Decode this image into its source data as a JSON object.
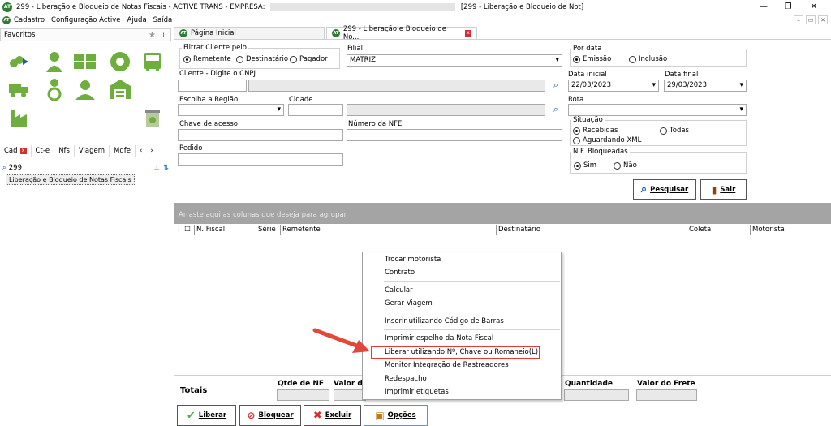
{
  "window": {
    "title_left": "299 - Liberação e Bloqueio de Notas Fiscais - ACTIVE TRANS - EMPRESA:",
    "title_right": "[299 - Liberação e Bloqueio de Not]"
  },
  "menu": [
    "Cadastro",
    "Configuração Active",
    "Ajuda",
    "Saída"
  ],
  "left": {
    "favorites_label": "Favoritos",
    "tabs": [
      "Cad",
      "Ct-e",
      "Nfs",
      "Viagem",
      "Mdfe"
    ],
    "search_value": "299",
    "tree_item": "Liberação e Bloqueio de Notas Fiscais"
  },
  "main_tabs": [
    {
      "label": "Página Inicial"
    },
    {
      "label": "299 - Liberação e Bloqueio de No..."
    }
  ],
  "form": {
    "filtrar_cliente": {
      "title": "Filtrar Cliente pelo",
      "options": [
        "Remetente",
        "Destinatário",
        "Pagador"
      ]
    },
    "filial": {
      "label": "Filial",
      "value": "MATRIZ"
    },
    "por_data": {
      "title": "Por data",
      "options": [
        "Emissão",
        "Inclusão"
      ]
    },
    "cliente_label": "Cliente - Digite o CNPJ",
    "data_inicial": {
      "label": "Data inicial",
      "value": "22/03/2023"
    },
    "data_final": {
      "label": "Data final",
      "value": "29/03/2023"
    },
    "escolha_regiao_label": "Escolha a Região",
    "cidade_label": "Cidade",
    "rota_label": "Rota",
    "situacao": {
      "title": "Situação",
      "options": [
        "Recebidas",
        "Todas",
        "Aguardando XML"
      ]
    },
    "chave_label": "Chave de acesso",
    "numero_nfe_label": "Número da NFE",
    "nf_bloqueadas": {
      "title": "N.F. Bloqueadas",
      "options": [
        "Sim",
        "Não"
      ]
    },
    "pedido_label": "Pedido",
    "pesquisar": "Pesquisar",
    "sair": "Sair"
  },
  "grid": {
    "group_hint": "Arraste aqui as colunas que deseja para agrupar",
    "columns": [
      "N. Fiscal",
      "Série",
      "Remetente",
      "Destinatário",
      "Coleta",
      "Motorista"
    ]
  },
  "context_menu": {
    "items": [
      "Trocar motorista",
      "Contrato",
      "Calcular",
      "Gerar Viagem",
      "Inserir utilizando Código de Barras",
      "Imprimir espelho da Nota Fiscal",
      "Liberar utilizando Nº, Chave ou Romaneio(L)",
      "Monitor Integração de Rastreadores",
      "Redespacho",
      "Imprimir etiquetas"
    ]
  },
  "totals": {
    "title": "Totais",
    "qtde_nf": "Qtde de NF",
    "valor": "Valor da",
    "quantidade": "Quantidade",
    "valor_frete": "Valor do Frete"
  },
  "actions": [
    "Liberar",
    "Bloquear",
    "Excluir",
    "Opções"
  ],
  "colors": {
    "accent_green": "#6dae3e",
    "highlight_red": "#e53935",
    "arrow_red": "#e0483a"
  }
}
